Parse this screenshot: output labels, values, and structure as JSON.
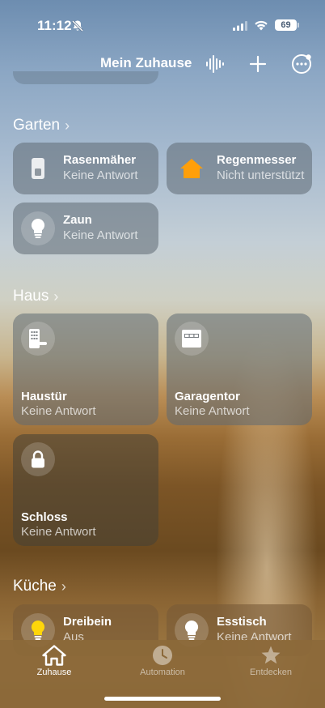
{
  "status": {
    "time": "11:12",
    "battery": "69"
  },
  "nav": {
    "title": "Mein Zuhause"
  },
  "sections": {
    "garten": {
      "title": "Garten"
    },
    "haus": {
      "title": "Haus"
    },
    "kueche": {
      "title": "Küche"
    }
  },
  "garten_tiles": [
    {
      "name": "Rasenmäher",
      "status": "Keine Antwort"
    },
    {
      "name": "Regenmesser",
      "status": "Nicht unterstützt"
    },
    {
      "name": "Zaun",
      "status": "Keine Antwort"
    }
  ],
  "haus_tiles": [
    {
      "name": "Haustür",
      "status": "Keine Antwort"
    },
    {
      "name": "Garagentor",
      "status": "Keine Antwort"
    },
    {
      "name": "Schloss",
      "status": "Keine Antwort"
    }
  ],
  "kueche_tiles": [
    {
      "name": "Dreibein",
      "status": "Aus"
    },
    {
      "name": "Esstisch",
      "status": "Keine Antwort"
    }
  ],
  "tabs": [
    {
      "label": "Zuhause",
      "active": true
    },
    {
      "label": "Automation",
      "active": false
    },
    {
      "label": "Entdecken",
      "active": false
    }
  ],
  "colors": {
    "accent_orange": "#ff9f0a",
    "bulb_on": "#ffd60a"
  }
}
